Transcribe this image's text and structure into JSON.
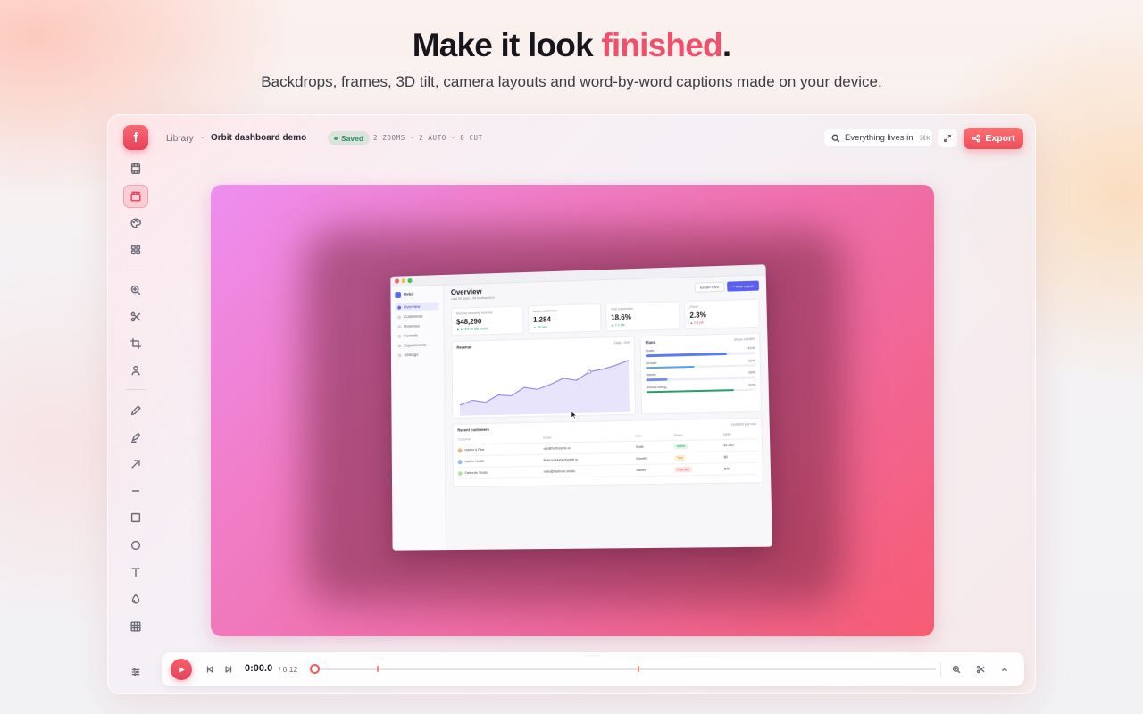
{
  "hero": {
    "title_main": "Make it look ",
    "title_accent": "finished",
    "title_end": ".",
    "subtitle": "Backdrops, frames, 3D tilt, camera layouts and word-by-word captions made on your device."
  },
  "app": {
    "logo_letter": "f",
    "breadcrumb": {
      "library": "Library",
      "separator": "·",
      "project": "Orbit dashboard demo"
    },
    "saved_label": "Saved",
    "stats": "2 ZOOMS · 2 AUTO · 0 CUT",
    "search_text": "Everything lives in",
    "search_shortcut": "⌘K",
    "export_label": "Export",
    "toolbar_icons": [
      "film-icon",
      "clapper-icon",
      "palette-icon",
      "grid-icon",
      "zoom-in-icon",
      "scissors-icon",
      "crop-icon",
      "person-icon",
      "pencil-icon",
      "highlighter-icon",
      "arrow-icon",
      "line-icon",
      "rectangle-icon",
      "circle-icon",
      "text-icon",
      "blur-icon",
      "table-icon"
    ],
    "active_tool": "clapper-icon",
    "colors": {
      "accent": "#ee4f5c",
      "saved_green": "#2f8a5a",
      "backdrop_start": "#ee8ef0",
      "backdrop_end": "#f65b72"
    }
  },
  "mockup": {
    "brand": "Orbit",
    "nav": [
      "Overview",
      "Customers",
      "Revenue",
      "Funnels",
      "Experiments",
      "Settings"
    ],
    "title": "Overview",
    "subtitle": "Last 30 days · All workspaces",
    "buttons": {
      "secondary": "Export CSV",
      "primary": "+ New report"
    },
    "kpis": [
      {
        "label": "Monthly recurring revenue",
        "value": "$48,290",
        "delta": "▲ 12.4% vs last month",
        "negative": false
      },
      {
        "label": "Active customers",
        "value": "1,284",
        "delta": "▲ 38 new",
        "negative": false
      },
      {
        "label": "Trial conversion",
        "value": "18.6%",
        "delta": "▲ 2.1 pts",
        "negative": false
      },
      {
        "label": "Churn",
        "value": "2.3%",
        "delta": "▲ 0.4 pts",
        "negative": true
      }
    ],
    "revenue_title": "Revenue",
    "revenue_range": "Daily · 30d",
    "revenue_values": [
      10,
      14,
      12,
      18,
      17,
      24,
      22,
      26,
      31,
      29,
      36,
      38,
      41,
      45
    ],
    "plans_title": "Plans",
    "plans_link": "Share of MRR",
    "plans": [
      {
        "name": "Scale",
        "pct": "41%",
        "share": 0.74,
        "color": "#5a7cf0"
      },
      {
        "name": "Growth",
        "pct": "31%",
        "share": 0.45,
        "color": "#5aa0f0"
      },
      {
        "name": "Starter",
        "pct": "16%",
        "share": 0.2,
        "color": "#7a8cf0"
      },
      {
        "name": "Annual billing",
        "pct": "62%",
        "share": 0.8,
        "color": "#2a9d6a"
      }
    ],
    "table_title": "Recent customers",
    "table_link": "Updated just now",
    "table_headers": [
      "Customer",
      "Email",
      "Plan",
      "Status",
      "MRR"
    ],
    "table_rows": [
      {
        "name": "Harbor & Pine",
        "email": "ops@harborpine.co",
        "plan": "Scale",
        "status": "Active",
        "status_bg": "#dff3e8",
        "status_fg": "#2a9d6a",
        "mrr": "$1,240",
        "dot": "#f5b27a"
      },
      {
        "name": "Lumen Health",
        "email": "finance@lumenhealth.io",
        "plan": "Growth",
        "status": "Trial",
        "status_bg": "#fdf0d6",
        "status_fg": "#c98a14",
        "mrr": "$0",
        "dot": "#9ab8f5"
      },
      {
        "name": "Fieldnote Studio",
        "email": "hello@fieldnote.studio",
        "plan": "Starter",
        "status": "Past due",
        "status_bg": "#fde2e4",
        "status_fg": "#d9485a",
        "mrr": "$49",
        "dot": "#b9dfa8"
      }
    ]
  },
  "timeline": {
    "current_time": "0:00.0",
    "total_time": "/ 0:12",
    "progress": 0.0,
    "markers": [
      0.1,
      0.52
    ]
  }
}
